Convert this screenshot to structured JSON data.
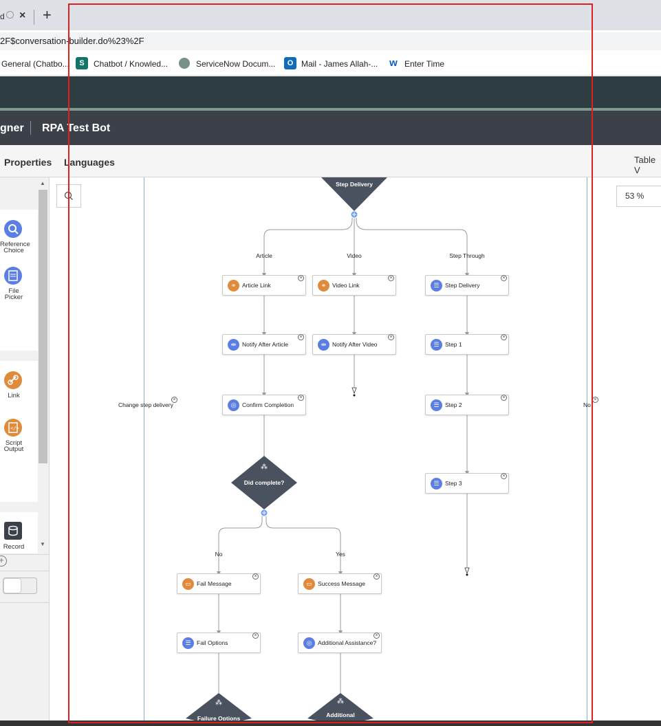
{
  "browser": {
    "tab_title": "d",
    "tab_close": "×",
    "new_tab": "+",
    "url": "2F$conversation-builder.do%23%2F",
    "bookmarks": [
      {
        "label": "General (Chatbo...",
        "icon": "teams-icon"
      },
      {
        "label": "Chatbot / Knowled...",
        "icon": "sharepoint-icon",
        "glyph": "S"
      },
      {
        "label": "ServiceNow Docum...",
        "icon": "servicenow-icon"
      },
      {
        "label": "Mail - James Allah-...",
        "icon": "outlook-icon",
        "glyph": "O"
      },
      {
        "label": "Enter Time",
        "icon": "workday-icon",
        "glyph": "w"
      }
    ]
  },
  "designer": {
    "title_prefix": "gner",
    "bot_name": "RPA Test Bot"
  },
  "tabs": {
    "properties": "Properties",
    "languages": "Languages",
    "table_view": "Table V"
  },
  "palette": {
    "items": [
      {
        "label": "Reference Choice",
        "icon": "search-icon",
        "color": "#5b7ee5"
      },
      {
        "label": "File Picker",
        "icon": "file-picker-icon",
        "color": "#5b7ee5"
      },
      {
        "label": "Link",
        "icon": "link-icon",
        "color": "#e08a3c"
      },
      {
        "label": "Script Output",
        "icon": "script-icon",
        "color": "#e08a3c"
      },
      {
        "label": "Record",
        "icon": "record-icon",
        "color": "#3c4048"
      }
    ]
  },
  "canvas": {
    "zoom": "53 %",
    "start_diamond": "Step Delivery",
    "branches": {
      "article": "Article",
      "video": "Video",
      "step_through": "Step Through"
    },
    "nodes": {
      "article_link": "Article Link",
      "video_link": "Video Link",
      "step_delivery": "Step Delivery",
      "notify_after_article": "Notify After Article",
      "notify_after_video": "Notify After Video",
      "step1": "Step 1",
      "confirm_completion": "Confirm Completion",
      "step2": "Step 2",
      "step3": "Step 3",
      "fail_message": "Fail Message",
      "success_message": "Success Message",
      "fail_options": "Fail Options",
      "additional_assistance": "Additional Assistance?"
    },
    "did_complete": "Did complete?",
    "cond_no": "No",
    "cond_yes": "Yes",
    "change_step_delivery": "Change step delivery",
    "lane_right_label": "No",
    "bottom_diamond_left": "Failure Options",
    "bottom_diamond_right": "Additional"
  },
  "colors": {
    "orange": "#e08a3c",
    "blue": "#5b7ee5",
    "header": "#2e3d41",
    "diamond": "#4a5260"
  }
}
